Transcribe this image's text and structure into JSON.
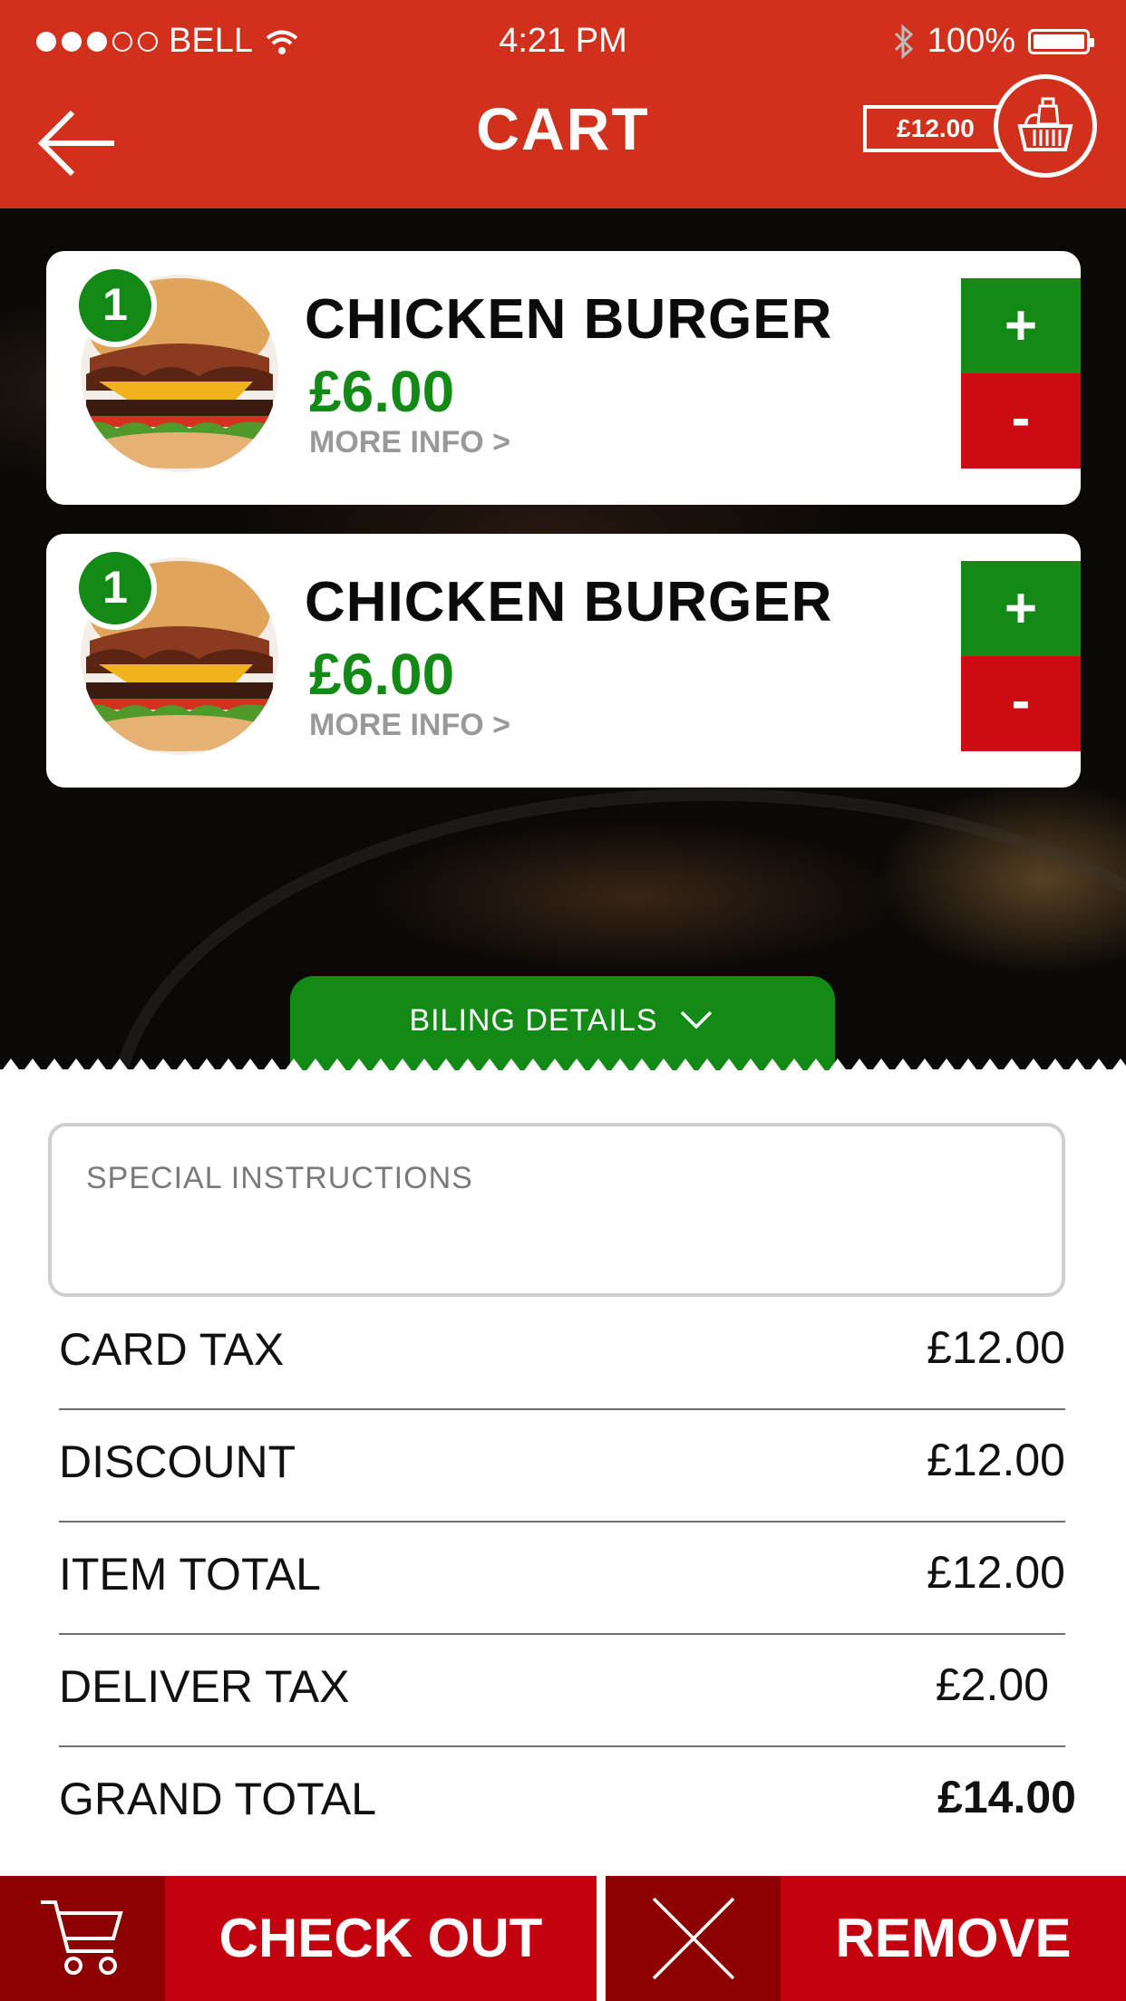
{
  "status_bar": {
    "carrier": "BELL",
    "time": "4:21 PM",
    "battery": "100%",
    "battery_level": 1.0
  },
  "header": {
    "title": "CART",
    "cart_total": "£12.00"
  },
  "cart_items": [
    {
      "qty": "1",
      "name": "CHICKEN BURGER",
      "price": "£6.00",
      "more_info": "MORE INFO >",
      "plus": "+",
      "minus": "-"
    },
    {
      "qty": "1",
      "name": "CHICKEN BURGER",
      "price": "£6.00",
      "more_info": "MORE INFO >",
      "plus": "+",
      "minus": "-"
    }
  ],
  "billing": {
    "tab_label": "BILING DETAILS",
    "instructions_placeholder": "SPECIAL INSTRUCTIONS",
    "rows": [
      {
        "label": "CARD TAX",
        "value": "£12.00"
      },
      {
        "label": "DISCOUNT",
        "value": "£12.00"
      },
      {
        "label": "ITEM TOTAL",
        "value": "£12.00"
      },
      {
        "label": "DELIVER TAX",
        "value": "£2.00"
      },
      {
        "label": "GRAND TOTAL",
        "value": "£14.00"
      }
    ]
  },
  "actions": {
    "checkout_label": "CHECK OUT",
    "remove_label": "REMOVE"
  },
  "colors": {
    "brand_red": "#d1301c",
    "green": "#128a15",
    "button_red": "#c4000f",
    "dark_red": "#8c0000"
  },
  "icons": [
    "signal-dots-icon",
    "wifi-icon",
    "bluetooth-icon",
    "battery-icon",
    "back-arrow-icon",
    "basket-icon",
    "chevron-down-icon",
    "cart-icon",
    "close-icon"
  ]
}
